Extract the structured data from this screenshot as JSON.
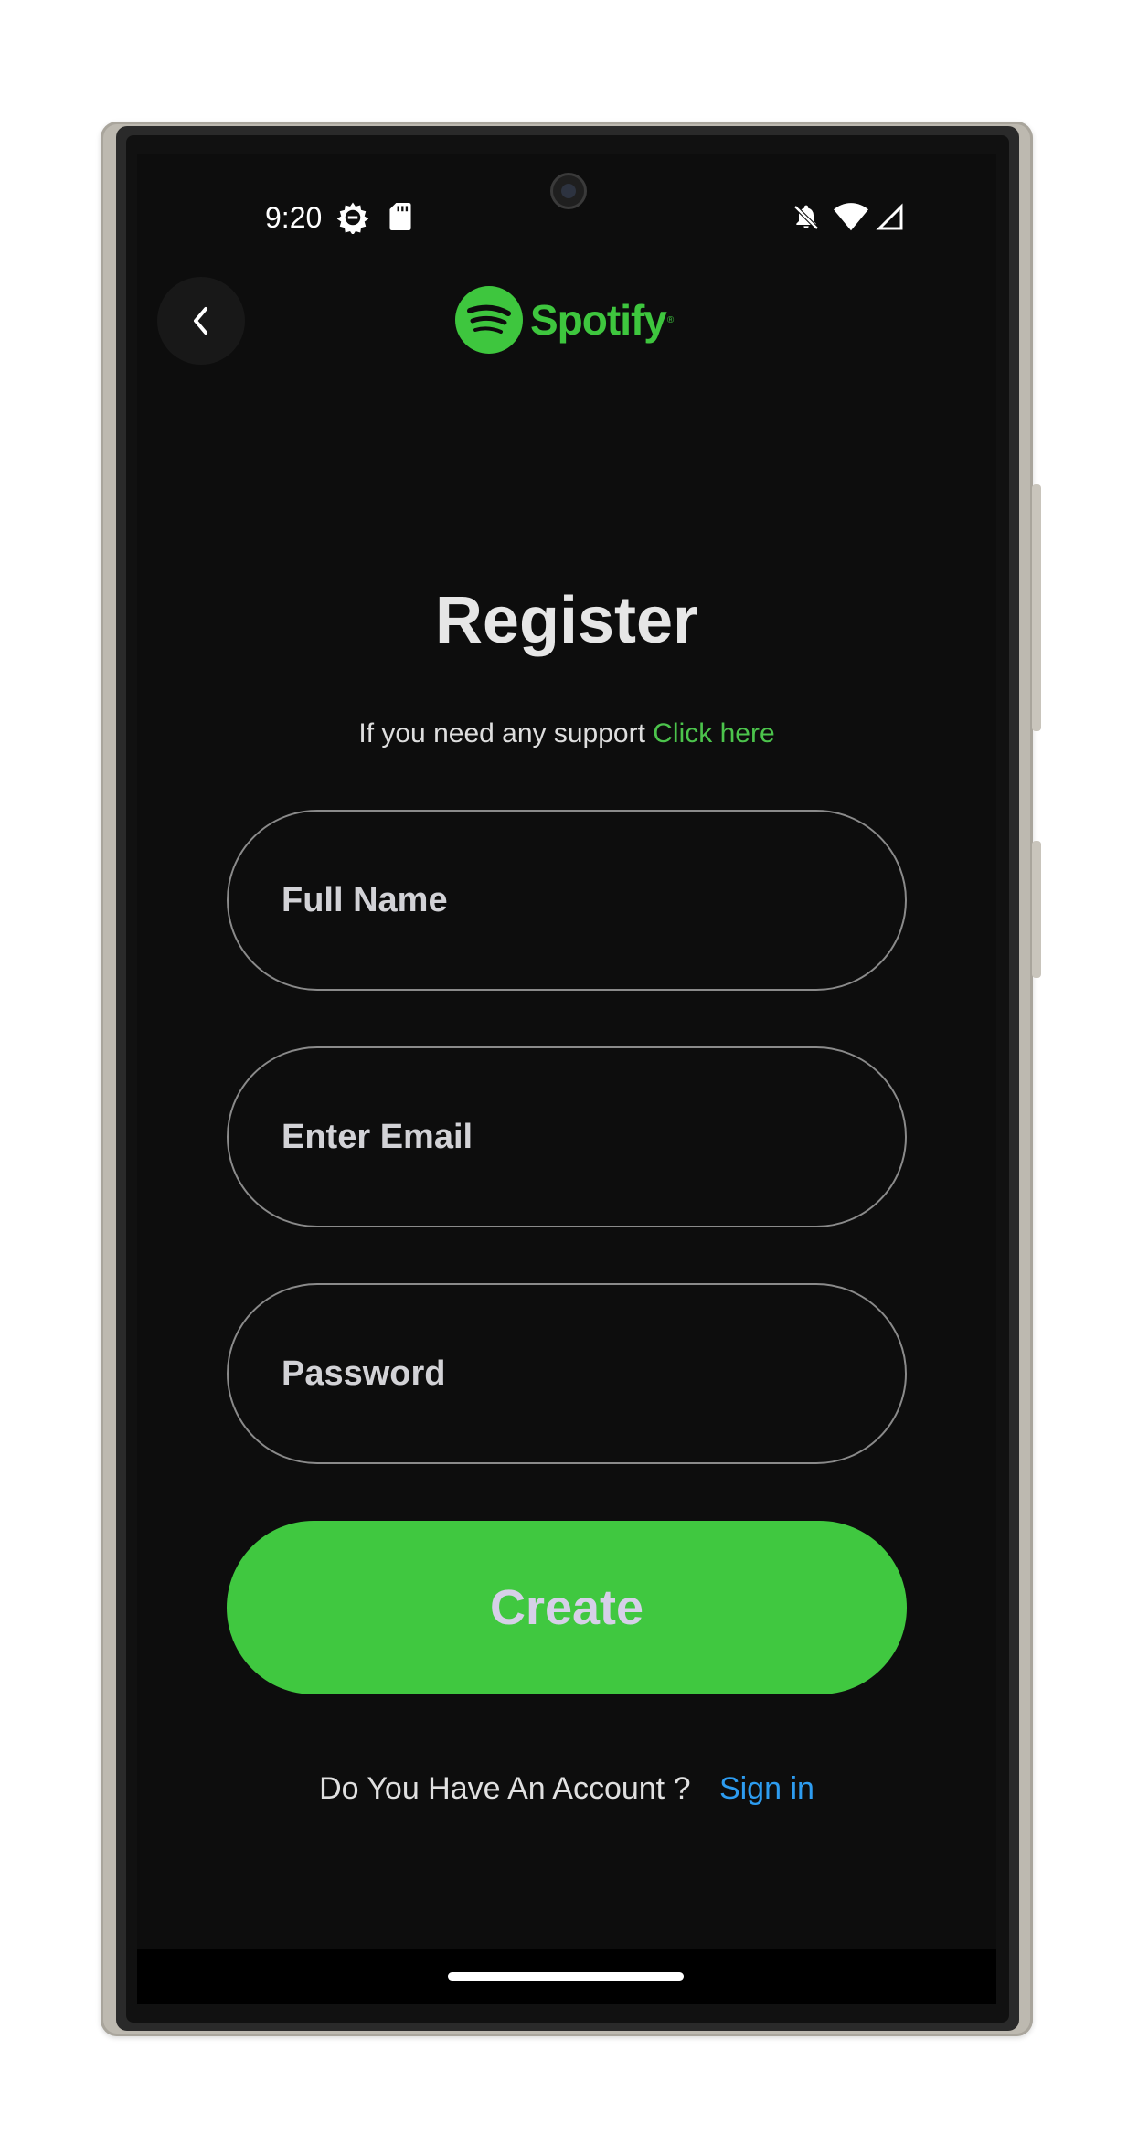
{
  "status_bar": {
    "time": "9:20",
    "icons": [
      "gear-icon",
      "sd-card-icon",
      "bell-off-icon",
      "wifi-icon",
      "signal-icon"
    ]
  },
  "header": {
    "back_icon": "chevron-left-icon",
    "logo_text": "Spotify",
    "logo_registered": "®"
  },
  "main": {
    "title": "Register",
    "support_text": "If you need any support",
    "support_link": "Click here",
    "fields": {
      "full_name_placeholder": "Full Name",
      "email_placeholder": "Enter Email",
      "password_placeholder": "Password"
    },
    "create_label": "Create",
    "account_prompt": "Do You Have An Account ?",
    "signin_link": "Sign in"
  },
  "colors": {
    "brand_green": "#3ec63e",
    "button_green": "#40c840",
    "link_blue": "#2d9cf0",
    "background": "#0d0d0d"
  }
}
